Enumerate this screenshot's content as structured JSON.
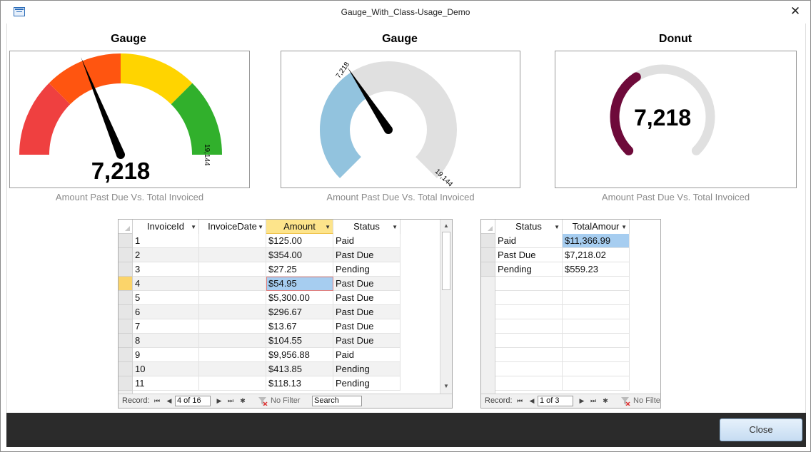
{
  "window": {
    "title": "Gauge_With_Class-Usage_Demo",
    "close_glyph": "✕"
  },
  "charts": [
    {
      "type": "gauge-bands",
      "title": "Gauge",
      "value_label": "7,218",
      "max_label": "19,144",
      "caption": "Amount Past Due Vs. Total Invoiced",
      "value": 7218.02,
      "max": 19144,
      "band_colors": [
        "#ef4040",
        "#ff5510",
        "#ffd400",
        "#31b02c"
      ]
    },
    {
      "type": "gauge-fill",
      "title": "Gauge",
      "value_label": "7,218",
      "max_label": "19,144",
      "caption": "Amount Past Due Vs. Total Invoiced",
      "value": 7218.02,
      "max": 19144,
      "fill_color": "#92c3de",
      "track_color": "#e0e0e0"
    },
    {
      "type": "donut",
      "title": "Donut",
      "value_label": "7,218",
      "caption": "Amount Past Due Vs. Total Invoiced",
      "value": 7218.02,
      "max": 19144,
      "fill_color": "#6e0a3a",
      "track_color": "#e0e0e0"
    }
  ],
  "invoices": {
    "columns": [
      "InvoiceId",
      "InvoiceDate",
      "Amount",
      "Status"
    ],
    "rows": [
      [
        "1",
        "",
        "$125.00",
        "Paid"
      ],
      [
        "2",
        "",
        "$354.00",
        "Past Due"
      ],
      [
        "3",
        "",
        "$27.25",
        "Pending"
      ],
      [
        "4",
        "",
        "$54.95",
        "Past Due"
      ],
      [
        "5",
        "",
        "$5,300.00",
        "Past Due"
      ],
      [
        "6",
        "",
        "$296.67",
        "Past Due"
      ],
      [
        "7",
        "",
        "$13.67",
        "Past Due"
      ],
      [
        "8",
        "",
        "$104.55",
        "Past Due"
      ],
      [
        "9",
        "",
        "$9,956.88",
        "Paid"
      ],
      [
        "10",
        "",
        "$413.85",
        "Pending"
      ],
      [
        "11",
        "",
        "$118.13",
        "Pending"
      ]
    ],
    "nav": {
      "record_label": "Record:",
      "position": "4 of 16",
      "filter_label": "No Filter",
      "search_placeholder": "Search"
    }
  },
  "summary": {
    "columns": [
      "Status",
      "TotalAmour"
    ],
    "rows": [
      [
        "Paid",
        "$11,366.99"
      ],
      [
        "Past Due",
        "$7,218.02"
      ],
      [
        "Pending",
        "$559.23"
      ]
    ],
    "nav": {
      "record_label": "Record:",
      "position": "1 of 3",
      "filter_label": "No Filte"
    }
  },
  "footer": {
    "close_label": "Close"
  }
}
